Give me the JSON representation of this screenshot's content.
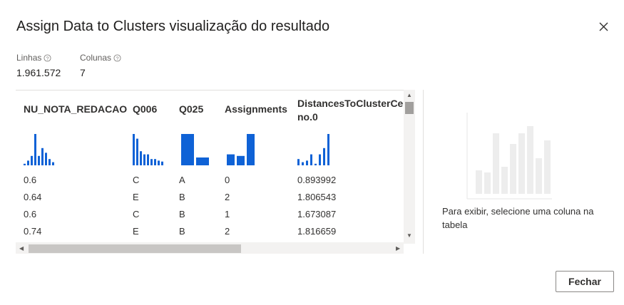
{
  "dialog": {
    "title": "Assign Data to Clusters visualização do resultado",
    "close_icon": "close-icon",
    "close_button": "Fechar"
  },
  "stats": {
    "rows_label": "Linhas",
    "rows_value": "1.961.572",
    "cols_label": "Colunas",
    "cols_value": "7"
  },
  "table": {
    "columns": [
      "NU_NOTA_REDACAO",
      "Q006",
      "Q025",
      "Assignments",
      "DistancesToClusterCenter",
      "no.0"
    ],
    "rows": [
      [
        "0.6",
        "C",
        "A",
        "0",
        "0.893992"
      ],
      [
        "0.64",
        "E",
        "B",
        "2",
        "1.806543"
      ],
      [
        "0.6",
        "C",
        "B",
        "1",
        "1.673087"
      ],
      [
        "0.74",
        "E",
        "B",
        "2",
        "1.816659"
      ]
    ],
    "histograms": {
      "nu_nota": [
        0.05,
        0.15,
        0.3,
        1.0,
        0.3,
        0.55,
        0.4,
        0.2,
        0.1
      ],
      "q006": [
        1.0,
        0.85,
        0.45,
        0.35,
        0.35,
        0.2,
        0.2,
        0.15,
        0.12
      ],
      "q025": [
        1.0,
        0.25
      ],
      "assignments": [
        0.35,
        0.3,
        1.0
      ],
      "distances": [
        0.2,
        0.1,
        0.15,
        0.35,
        0.05,
        0.35,
        0.55,
        1.0
      ]
    }
  },
  "side_panel": {
    "message": "Para exibir, selecione uma coluna na tabela",
    "placeholder_bars": [
      0.33,
      0.3,
      0.85,
      0.38,
      0.7,
      0.85,
      0.95,
      0.5,
      0.75
    ]
  },
  "colors": {
    "accent": "#0f62d6",
    "placeholder": "#ededed"
  }
}
